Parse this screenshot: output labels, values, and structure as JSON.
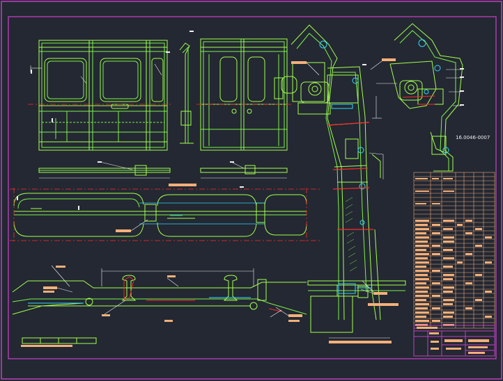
{
  "drawing": {
    "part_number": "16.0046-0007",
    "colors": {
      "background": "#232832",
      "frame": "#c13fc2",
      "outline": "#a6ff4e",
      "detail": "#7cf24a",
      "cyan": "#34d6ff",
      "dimension": "#f2f2f2",
      "hatch_red": "#ff2b2b",
      "label_fill": "#f4b07a",
      "table_line": "#f0a878"
    },
    "views": [
      "door-front-elevation",
      "door-rear-elevation",
      "door-side-section",
      "door-plan-section",
      "threshold-section",
      "upper-mechanism-detail",
      "body-profile-section"
    ],
    "parts_list": {
      "rows": 22,
      "columns": 7
    },
    "title_block": {
      "cells": 12
    }
  }
}
